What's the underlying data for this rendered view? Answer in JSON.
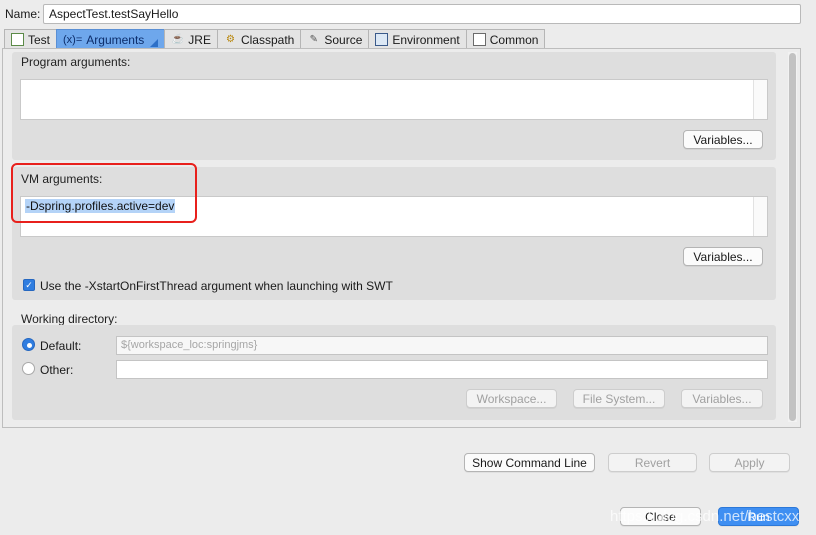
{
  "name_label": "Name:",
  "name_value": "AspectTest.testSayHello",
  "tabs": [
    {
      "label": "Test",
      "icon": "junit-doc-icon"
    },
    {
      "label": "Arguments",
      "icon": "arguments-icon",
      "prefix": "(x)="
    },
    {
      "label": "JRE",
      "icon": "jre-icon"
    },
    {
      "label": "Classpath",
      "icon": "classpath-icon"
    },
    {
      "label": "Source",
      "icon": "source-icon"
    },
    {
      "label": "Environment",
      "icon": "environment-icon"
    },
    {
      "label": "Common",
      "icon": "common-icon"
    }
  ],
  "program_args": {
    "label": "Program arguments:",
    "value": "",
    "variables_button": "Variables..."
  },
  "vm_args": {
    "label": "VM arguments:",
    "value": "-Dspring.profiles.active=dev",
    "variables_button": "Variables..."
  },
  "xstart_checkbox": {
    "label": "Use the -XstartOnFirstThread argument when launching with SWT",
    "checked": true
  },
  "working_dir": {
    "label": "Working directory:",
    "default_label": "Default:",
    "default_value": "${workspace_loc:springjms}",
    "other_label": "Other:",
    "other_value": "",
    "workspace_button": "Workspace...",
    "filesystem_button": "File System...",
    "variables_button": "Variables..."
  },
  "footer": {
    "show_command_line": "Show Command Line",
    "revert": "Revert",
    "apply": "Apply",
    "close": "Close",
    "run": "Run"
  },
  "watermark": "https://blog.csdn.net/bestcxx",
  "colors": {
    "accent": "#2f7de0",
    "highlight_border": "#e8201c",
    "selection": "#b4d3f7"
  }
}
